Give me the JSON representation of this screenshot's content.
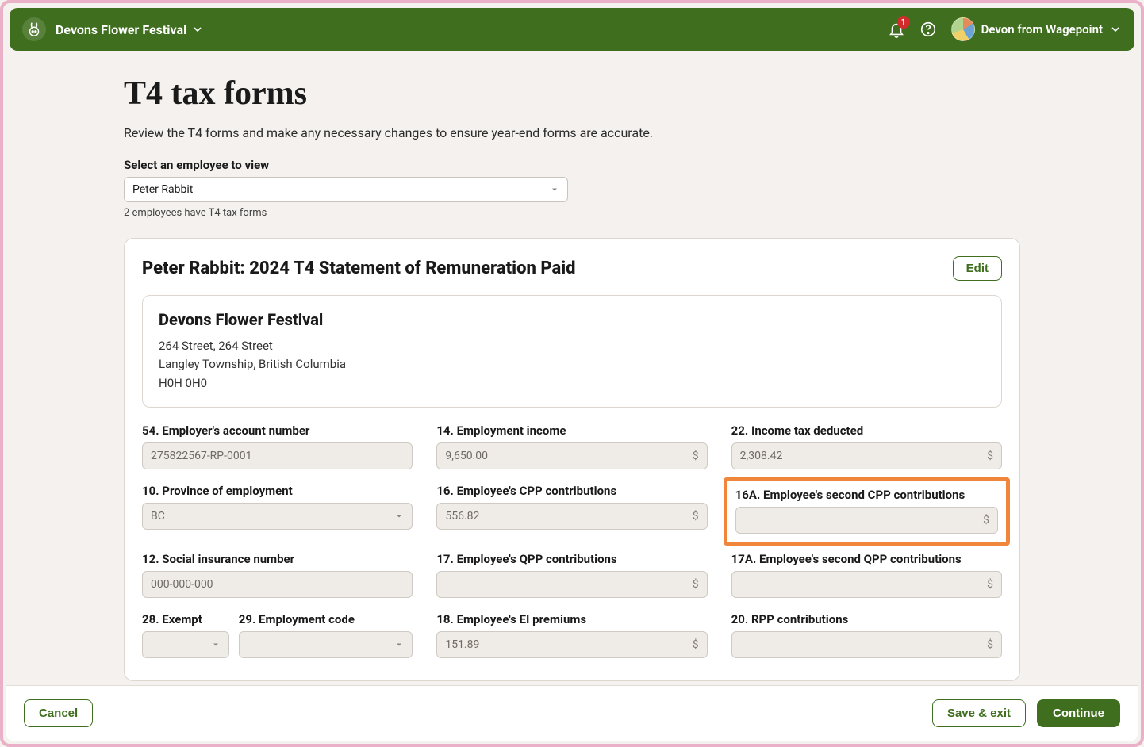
{
  "topbar": {
    "company_name": "Devons Flower Festival",
    "notif_count": "1",
    "user_name": "Devon from Wagepoint"
  },
  "page": {
    "title": "T4 tax forms",
    "subtitle": "Review the T4 forms and make any necessary changes to ensure year-end forms are accurate.",
    "select_label": "Select an employee to view",
    "selected_employee": "Peter Rabbit",
    "employee_hint": "2 employees have T4 tax forms"
  },
  "card": {
    "title": "Peter Rabbit: 2024 T4 Statement of Remuneration Paid",
    "edit_label": "Edit",
    "company": {
      "name": "Devons Flower Festival",
      "line1": "264 Street, 264 Street",
      "line2": "Langley Township, British Columbia",
      "line3": "H0H 0H0"
    },
    "fields": {
      "f54": {
        "label": "54. Employer's account number",
        "value": "275822567-RP-0001"
      },
      "f10": {
        "label": "10. Province of employment",
        "value": "BC"
      },
      "f12": {
        "label": "12. Social insurance number",
        "value": "000-000-000"
      },
      "f28": {
        "label": "28. Exempt",
        "value": ""
      },
      "f29": {
        "label": "29. Employment code",
        "value": ""
      },
      "f14": {
        "label": "14. Employment income",
        "value": "9,650.00"
      },
      "f16": {
        "label": "16. Employee's CPP contributions",
        "value": "556.82"
      },
      "f17": {
        "label": "17. Employee's QPP contributions",
        "value": ""
      },
      "f18": {
        "label": "18. Employee's EI premiums",
        "value": "151.89"
      },
      "f22": {
        "label": "22. Income tax deducted",
        "value": "2,308.42"
      },
      "f16a": {
        "label": "16A. Employee's second CPP contributions",
        "value": ""
      },
      "f17a": {
        "label": "17A. Employee's second QPP contributions",
        "value": ""
      },
      "f20": {
        "label": "20. RPP contributions",
        "value": ""
      }
    }
  },
  "footer": {
    "cancel": "Cancel",
    "save_exit": "Save & exit",
    "continue": "Continue"
  }
}
